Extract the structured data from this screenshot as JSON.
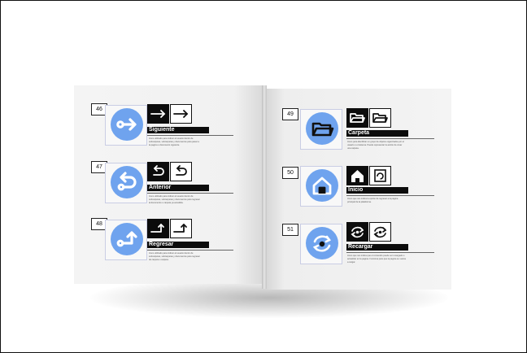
{
  "colors": {
    "accent": "#6fa3ee",
    "ink": "#0c0c0c",
    "paper": "#f3f3f3"
  },
  "entries": [
    {
      "number": "46",
      "title": "Siguiente",
      "icon": "arrow-right-icon",
      "description": "Icono utilizado para indicar al usuario dentro de subcarpetas, subcarpetas y documentos para pasar a la pagina o documento siguiente."
    },
    {
      "number": "47",
      "title": "Anterior",
      "icon": "arrow-back-icon",
      "description": "Icono utilizado para indicar al usuario dentro de subcarpetas, subcarpetas y documentos para regresar al documento o carpeta ya accedida."
    },
    {
      "number": "48",
      "title": "Regresar",
      "icon": "arrow-return-icon",
      "description": "Icono utilizado para indicar al usuario dentro de subcarpetas, subcarpetas y documentos para regresar de carpeta o carpeta."
    },
    {
      "number": "49",
      "title": "Carpeta",
      "icon": "folder-icon",
      "description": "Icono para identificar un grupo de objetos organizados por el usuario o el sistema. Puede representar la acción de crear una carpeta."
    },
    {
      "number": "50",
      "title": "Inicio",
      "icon": "home-icon",
      "description": "Icono que nos indica la opción de regresar a la página principal de la plataforma."
    },
    {
      "number": "51",
      "title": "Recargar",
      "icon": "reload-icon",
      "description": "Icono que nos indica que el contenido puede ser recargado o actualizar en la pagina. Funciona para que la pagina se vuelva a cargar."
    }
  ]
}
